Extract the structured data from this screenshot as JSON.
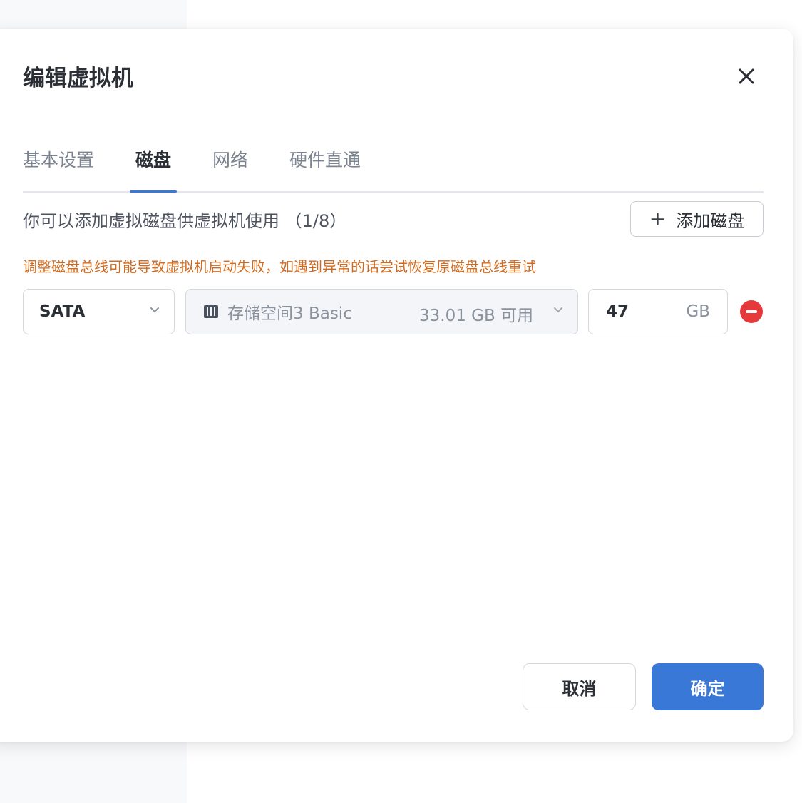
{
  "dialog": {
    "title": "编辑虚拟机",
    "close_icon": "close-icon"
  },
  "tabs": [
    {
      "label": "基本设置",
      "active": false
    },
    {
      "label": "磁盘",
      "active": true
    },
    {
      "label": "网络",
      "active": false
    },
    {
      "label": "硬件直通",
      "active": false
    }
  ],
  "disk_panel": {
    "description": "你可以添加虚拟磁盘供虚拟机使用 （1/8）",
    "add_button_label": "添加磁盘",
    "add_button_icon": "plus-icon",
    "warning": "调整磁盘总线可能导致虚拟机启动失败，如遇到异常的话尝试恢复原磁盘总线重试"
  },
  "disks": [
    {
      "bus": "SATA",
      "storage_name": "存储空间3 Basic",
      "storage_free": "33.01 GB 可用",
      "storage_icon": "storage-icon",
      "size_value": "47",
      "size_unit": "GB"
    }
  ],
  "footer": {
    "cancel_label": "取消",
    "ok_label": "确定"
  },
  "colors": {
    "accent": "#3a78d8",
    "warning": "#d06a1f",
    "danger": "#e5393b"
  }
}
